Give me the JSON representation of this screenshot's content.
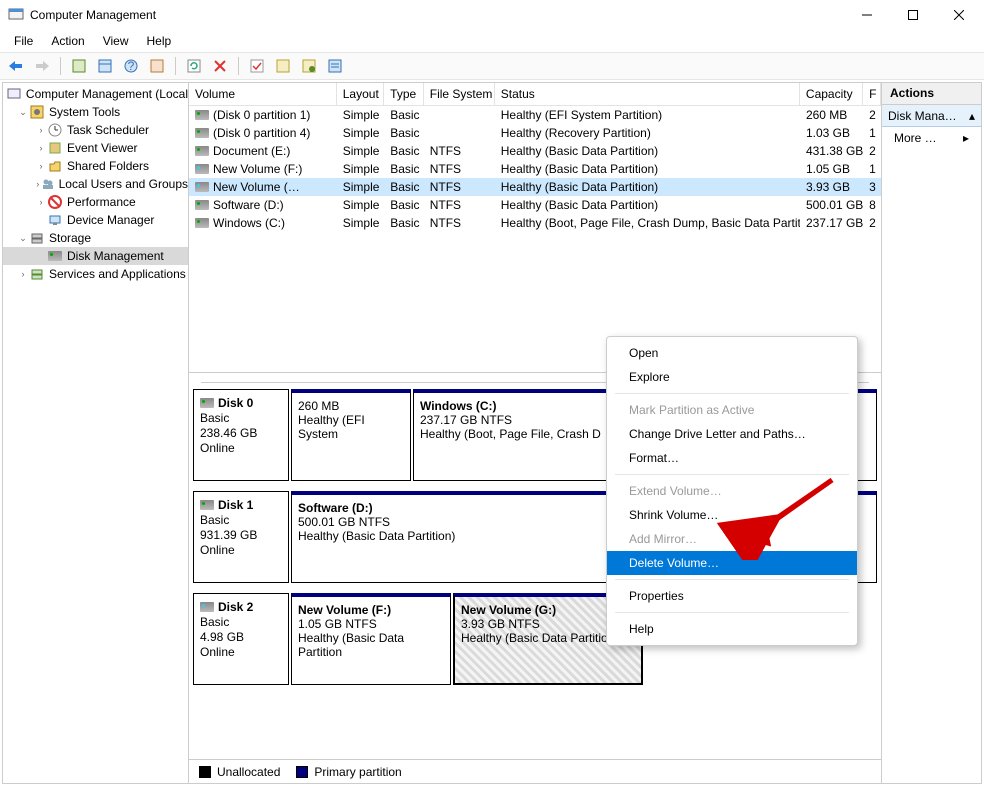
{
  "title": "Computer Management",
  "menubar": {
    "file": "File",
    "action": "Action",
    "view": "View",
    "help": "Help"
  },
  "tree": {
    "root": "Computer Management (Local",
    "system_tools": "System Tools",
    "task_scheduler": "Task Scheduler",
    "event_viewer": "Event Viewer",
    "shared_folders": "Shared Folders",
    "local_users": "Local Users and Groups",
    "performance": "Performance",
    "device_manager": "Device Manager",
    "storage": "Storage",
    "disk_management": "Disk Management",
    "services_apps": "Services and Applications"
  },
  "columns": {
    "volume": "Volume",
    "layout": "Layout",
    "type": "Type",
    "fs": "File System",
    "status": "Status",
    "capacity": "Capacity",
    "f": "F"
  },
  "volumes": [
    {
      "name": "(Disk 0 partition 1)",
      "layout": "Simple",
      "type": "Basic",
      "fs": "",
      "status": "Healthy (EFI System Partition)",
      "capacity": "260 MB",
      "f": "2"
    },
    {
      "name": "(Disk 0 partition 4)",
      "layout": "Simple",
      "type": "Basic",
      "fs": "",
      "status": "Healthy (Recovery Partition)",
      "capacity": "1.03 GB",
      "f": "1"
    },
    {
      "name": "Document (E:)",
      "layout": "Simple",
      "type": "Basic",
      "fs": "NTFS",
      "status": "Healthy (Basic Data Partition)",
      "capacity": "431.38 GB",
      "f": "2"
    },
    {
      "name": "New Volume (F:)",
      "layout": "Simple",
      "type": "Basic",
      "fs": "NTFS",
      "status": "Healthy (Basic Data Partition)",
      "capacity": "1.05 GB",
      "f": "1"
    },
    {
      "name": "New Volume (…",
      "layout": "Simple",
      "type": "Basic",
      "fs": "NTFS",
      "status": "Healthy (Basic Data Partition)",
      "capacity": "3.93 GB",
      "f": "3",
      "selected": true
    },
    {
      "name": "Software (D:)",
      "layout": "Simple",
      "type": "Basic",
      "fs": "NTFS",
      "status": "Healthy (Basic Data Partition)",
      "capacity": "500.01 GB",
      "f": "8"
    },
    {
      "name": "Windows (C:)",
      "layout": "Simple",
      "type": "Basic",
      "fs": "NTFS",
      "status": "Healthy (Boot, Page File, Crash Dump, Basic Data Partition)",
      "capacity": "237.17 GB",
      "f": "2"
    }
  ],
  "disks": {
    "d0": {
      "name": "Disk 0",
      "type": "Basic",
      "size": "238.46 GB",
      "status": "Online",
      "p1": {
        "size": "260 MB",
        "status": "Healthy (EFI System"
      },
      "p2": {
        "name": "Windows  (C:)",
        "size": "237.17 GB NTFS",
        "status": "Healthy (Boot, Page File, Crash D"
      }
    },
    "d1": {
      "name": "Disk 1",
      "type": "Basic",
      "size": "931.39 GB",
      "status": "Online",
      "p1": {
        "name": "Software  (D:)",
        "size": "500.01 GB NTFS",
        "status": "Healthy (Basic Data Partition)"
      }
    },
    "d2": {
      "name": "Disk 2",
      "type": "Basic",
      "size": "4.98 GB",
      "status": "Online",
      "p1": {
        "name": "New Volume  (F:)",
        "size": "1.05 GB NTFS",
        "status": "Healthy (Basic Data Partition"
      },
      "p2": {
        "name": "New Volume  (G:)",
        "size": "3.93 GB NTFS",
        "status": "Healthy (Basic Data Partition)"
      }
    }
  },
  "legend": {
    "unalloc": "Unallocated",
    "primary": "Primary partition"
  },
  "actions": {
    "header": "Actions",
    "section": "Disk Mana…",
    "more": "More …"
  },
  "context_menu": {
    "open": "Open",
    "explore": "Explore",
    "mark_active": "Mark Partition as Active",
    "change_letter": "Change Drive Letter and Paths…",
    "format": "Format…",
    "extend": "Extend Volume…",
    "shrink": "Shrink Volume…",
    "add_mirror": "Add Mirror…",
    "delete": "Delete Volume…",
    "properties": "Properties",
    "help": "Help"
  }
}
